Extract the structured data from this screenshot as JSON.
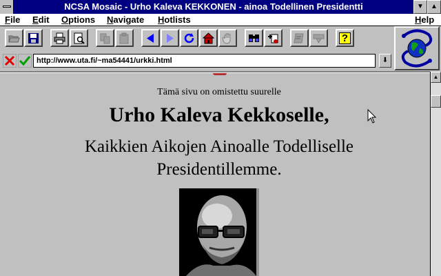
{
  "window": {
    "title": "NCSA Mosaic - Urho Kaleva KEKKONEN - ainoa Todellinen Presidentti",
    "minimize_glyph": "▼",
    "maximize_glyph": "▲"
  },
  "menu": {
    "file": "File",
    "edit": "Edit",
    "options": "Options",
    "navigate": "Navigate",
    "hotlists": "Hotlists",
    "help": "Help"
  },
  "toolbar": {
    "icons": [
      "open-folder-icon",
      "save-disk-icon",
      "print-icon",
      "print-preview-icon",
      "copy-icon",
      "paste-icon",
      "back-arrow-icon",
      "forward-arrow-icon",
      "reload-icon",
      "home-icon",
      "stop-hand-icon",
      "find-binoculars-icon",
      "add-hotlist-icon",
      "annotate-icon",
      "news-icon",
      "help-question-icon"
    ],
    "help_glyph": "?"
  },
  "address": {
    "url": "http://www.uta.fi/~ma54441/urkki.html",
    "dropdown_glyph": "⬇"
  },
  "scrollbar": {
    "up_glyph": "▲"
  },
  "content": {
    "dedication": "Tämä sivu on omistettu suurelle",
    "heading": "Urho Kaleva Kekkoselle,",
    "subtitle": "Kaikkien Aikojen Ainoalle Todelliselle Presidentillemme."
  },
  "colors": {
    "titlebar": "#000080",
    "chrome": "#c0c0c0",
    "back_forward": "#0000ff"
  }
}
